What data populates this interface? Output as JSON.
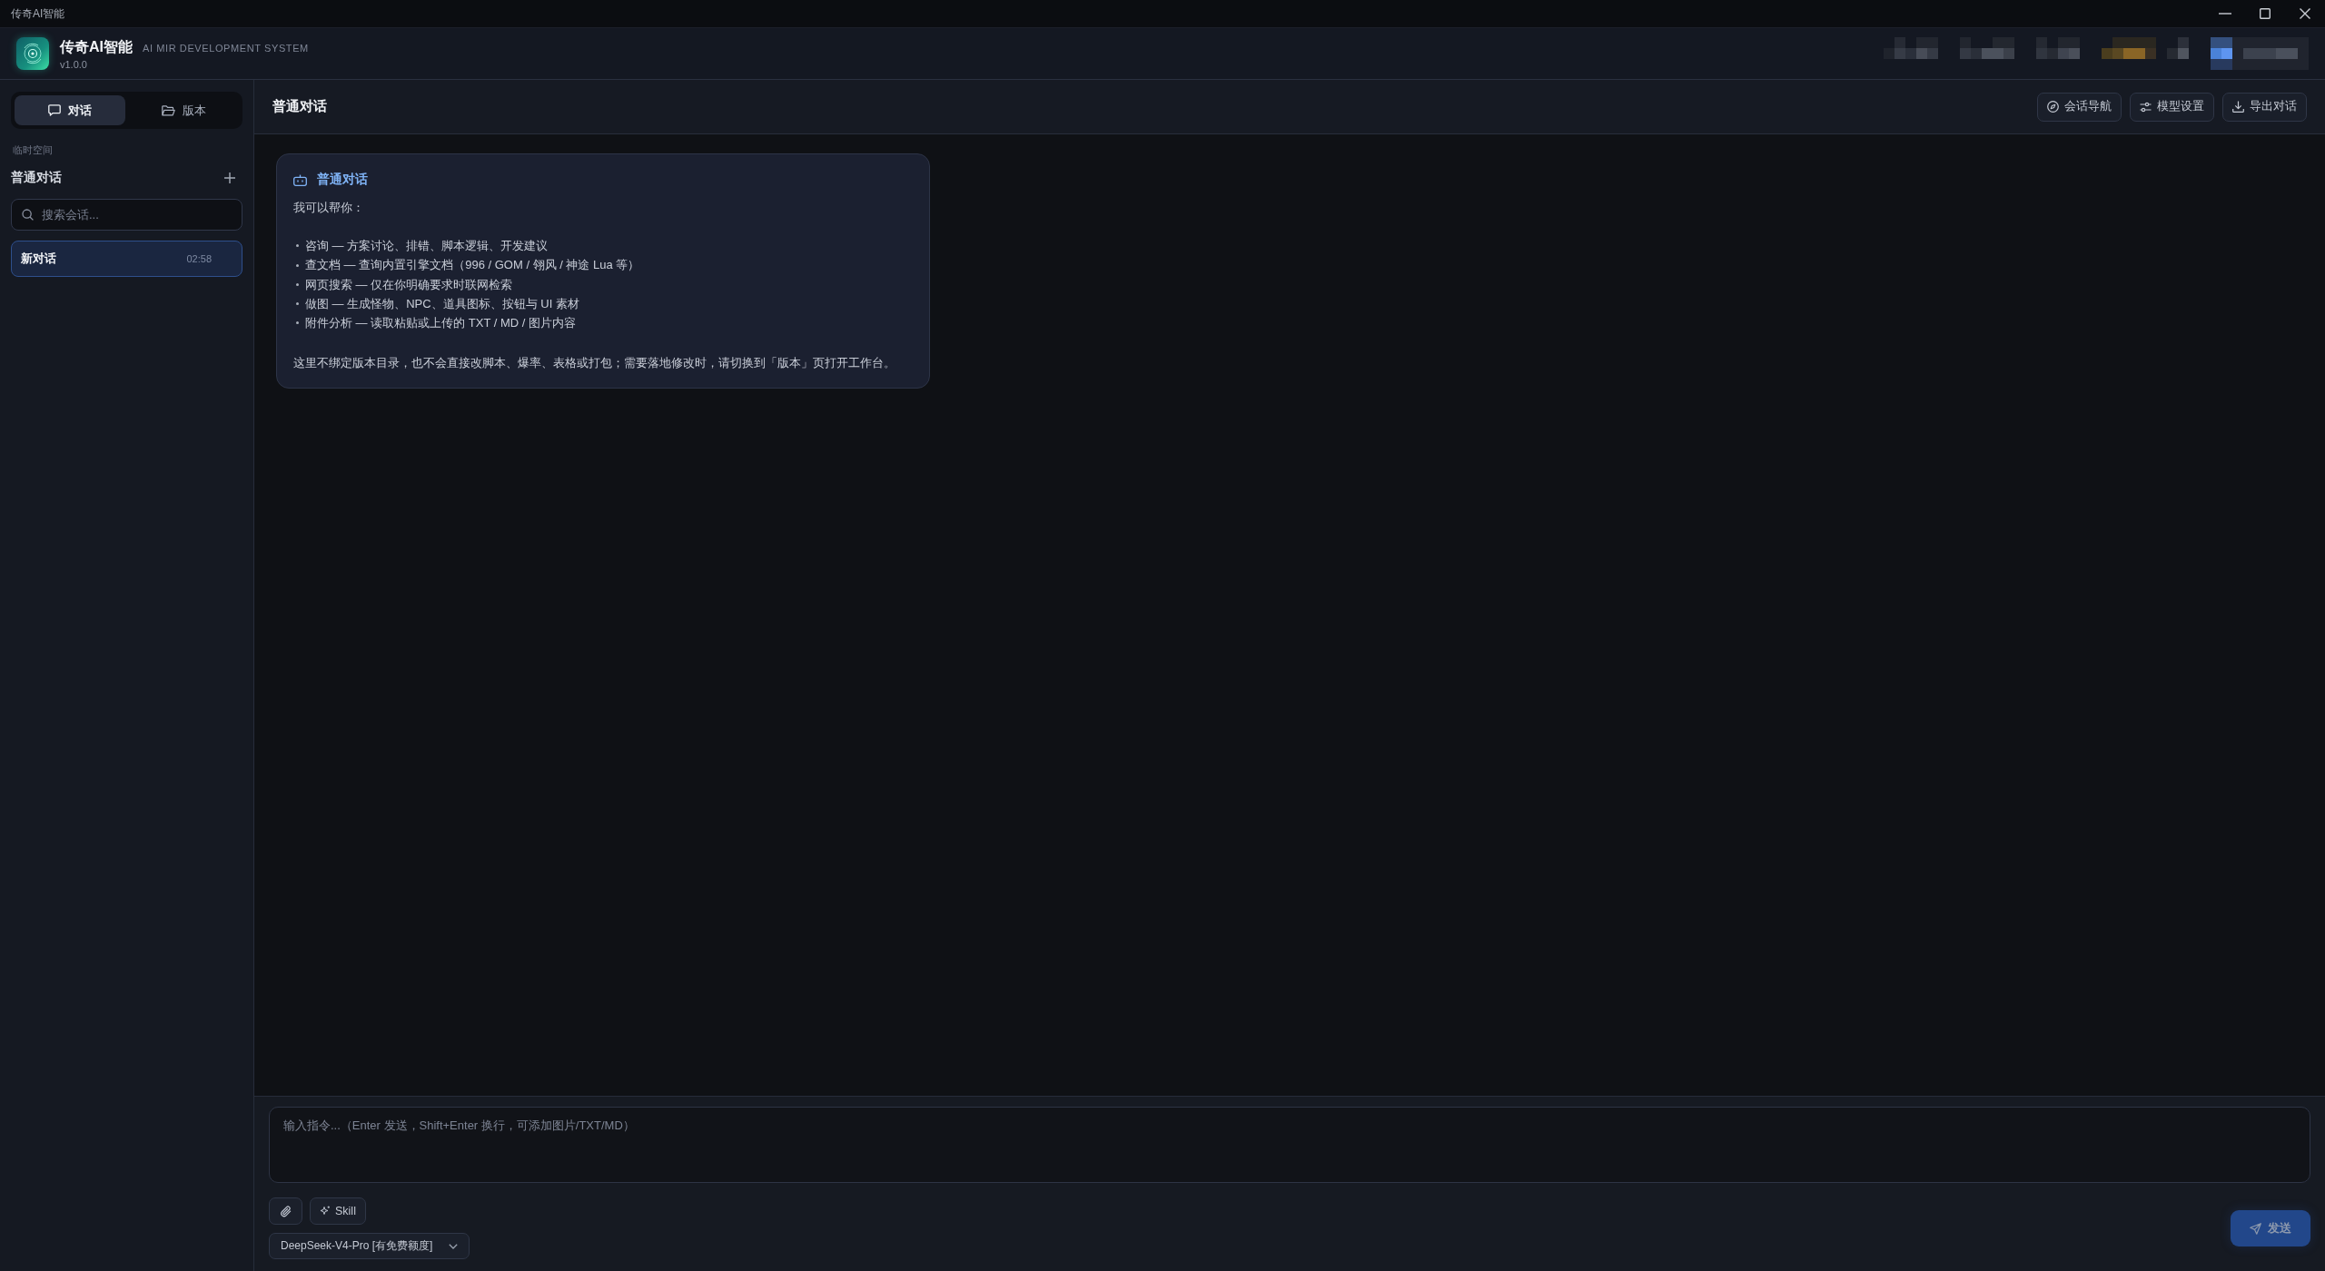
{
  "window": {
    "title": "传奇AI智能"
  },
  "header": {
    "app_name": "传奇AI智能",
    "subtitle": "AI MIR DEVELOPMENT SYSTEM",
    "version": "v1.0.0"
  },
  "sidebar": {
    "tabs": [
      {
        "label": "对话",
        "selected": true
      },
      {
        "label": "版本",
        "selected": false
      }
    ],
    "section_label": "临时空间",
    "group_title": "普通对话",
    "search": {
      "placeholder": "搜索会话..."
    },
    "conversations": [
      {
        "title": "新对话",
        "time": "02:58",
        "selected": true
      }
    ]
  },
  "main": {
    "title": "普通对话",
    "toolbar": [
      {
        "label": "会话导航"
      },
      {
        "label": "模型设置"
      },
      {
        "label": "导出对话"
      }
    ],
    "messages": [
      {
        "title": "普通对话",
        "intro": "我可以帮你：",
        "items": [
          "咨询 — 方案讨论、排错、脚本逻辑、开发建议",
          "查文档 — 查询内置引擎文档（996 / GOM / 翎风 / 神途 Lua 等）",
          "网页搜索 — 仅在你明确要求时联网检索",
          "做图 — 生成怪物、NPC、道具图标、按钮与 UI 素材",
          "附件分析 — 读取粘贴或上传的 TXT / MD / 图片内容"
        ],
        "closing": "这里不绑定版本目录，也不会直接改脚本、爆率、表格或打包；需要落地修改时，请切换到「版本」页打开工作台。"
      }
    ]
  },
  "composer": {
    "placeholder": "输入指令...（Enter 发送，Shift+Enter 换行，可添加图片/TXT/MD）",
    "tools": [
      {
        "kind": "attach"
      },
      {
        "kind": "skill",
        "label": "Skill"
      }
    ],
    "model": "DeepSeek-V4-Pro [有免费额度]",
    "send": {
      "label": "发送",
      "disabled": true
    }
  }
}
